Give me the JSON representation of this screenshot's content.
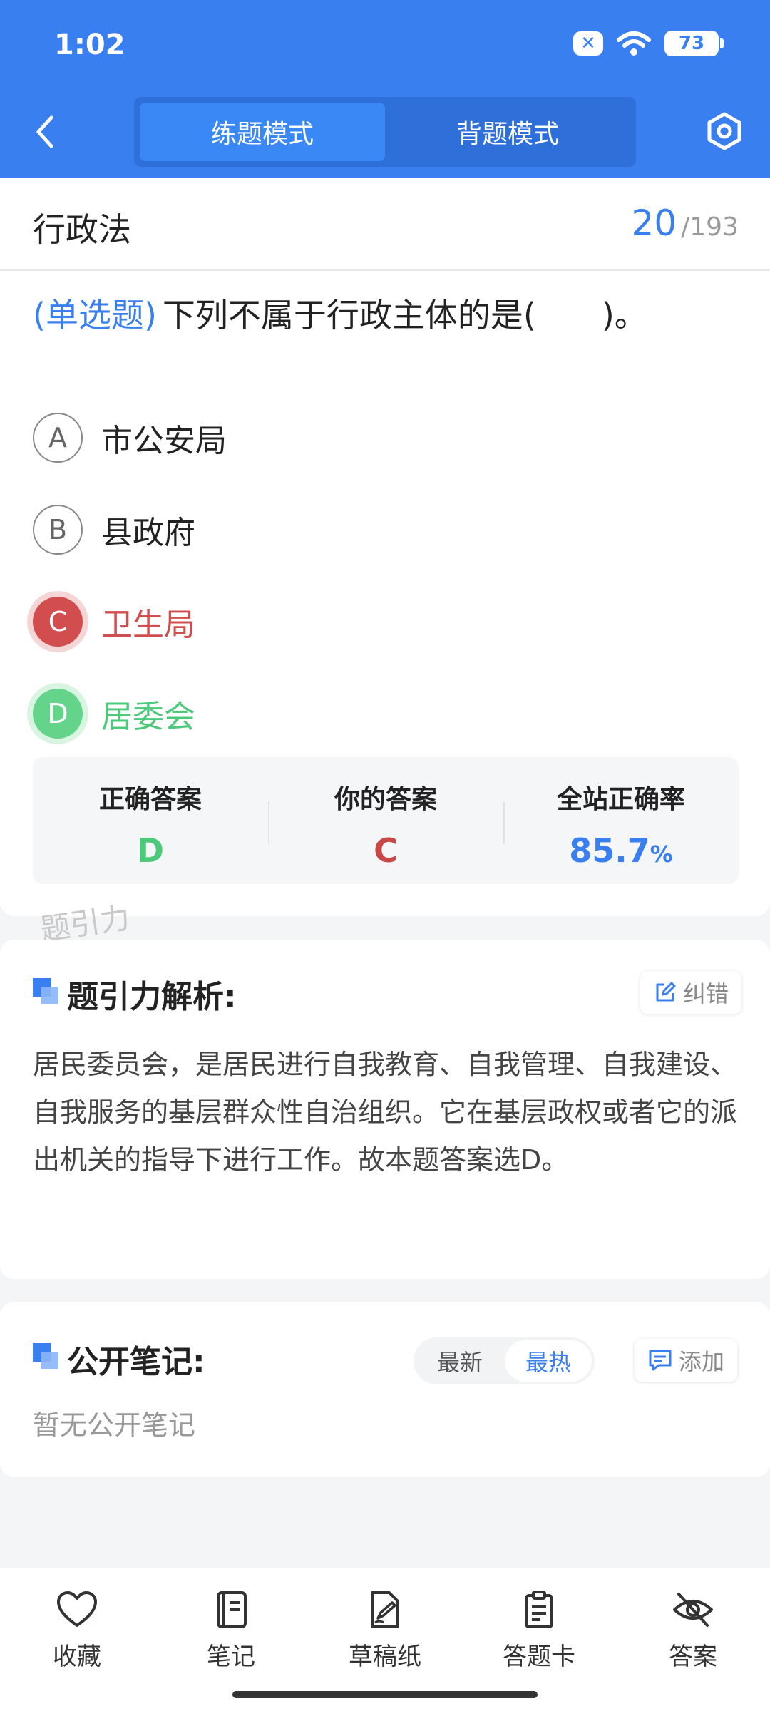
{
  "status_bar": {
    "time": "1:02",
    "battery": "73"
  },
  "header": {
    "tabs": [
      {
        "label": "练题模式"
      },
      {
        "label": "背题模式"
      }
    ]
  },
  "question": {
    "subject": "行政法",
    "current": "20",
    "separator": "/",
    "total": "193",
    "type_label": "(单选题)",
    "text": "下列不属于行政主体的是(　　)。",
    "options": [
      {
        "letter": "A",
        "text": "市公安局"
      },
      {
        "letter": "B",
        "text": "县政府"
      },
      {
        "letter": "C",
        "text": "卫生局"
      },
      {
        "letter": "D",
        "text": "居委会"
      }
    ],
    "colors": {
      "wrong": "#d24e4e",
      "correct": "#4cc97a",
      "accent": "#3a7ff0"
    }
  },
  "stats": {
    "correct_label": "正确答案",
    "correct_value": "D",
    "yours_label": "你的答案",
    "yours_value": "C",
    "rate_label": "全站正确率",
    "rate_value": "85.7",
    "rate_unit": "%"
  },
  "watermark": "题引力",
  "analysis": {
    "title": "题引力解析:",
    "correct_button": "纠错",
    "text": "居民委员会，是居民进行自我教育、自我管理、自我建设、自我服务的基层群众性自治组织。它在基层政权或者它的派出机关的指导下进行工作。故本题答案选D。"
  },
  "notes": {
    "title": "公开笔记:",
    "sort_newest": "最新",
    "sort_hottest": "最热",
    "add_button": "添加",
    "empty_text": "暂无公开笔记"
  },
  "tabbar": {
    "items": [
      {
        "label": "收藏",
        "icon": "heart-icon"
      },
      {
        "label": "笔记",
        "icon": "notebook-icon"
      },
      {
        "label": "草稿纸",
        "icon": "draft-icon"
      },
      {
        "label": "答题卡",
        "icon": "clipboard-icon"
      },
      {
        "label": "答案",
        "icon": "eye-off-icon"
      }
    ]
  }
}
